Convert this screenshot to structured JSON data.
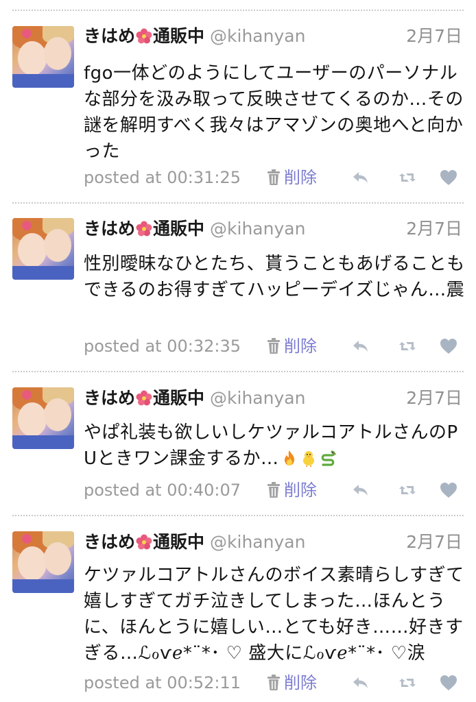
{
  "tweets": [
    {
      "name_a": "きはめ",
      "name_b": "通販中",
      "handle": "@kihanyan",
      "date": "2月7日",
      "text": "fgo一体どのようにしてユーザーのパーソナルな部分を汲み取って反映させてくるのか…その謎を解明すべく我々はアマゾンの奥地へと向かった",
      "text_suffix": "",
      "posted": "posted at 00:31:25",
      "delete_label": "削除"
    },
    {
      "name_a": "きはめ",
      "name_b": "通販中",
      "handle": "@kihanyan",
      "date": "2月7日",
      "text": "性別曖昧なひとたち、貰うこともあげることもできるのお得すぎてハッピーデイズじゃん…震",
      "text_suffix": "",
      "posted": "posted at 00:32:35",
      "delete_label": "削除"
    },
    {
      "name_a": "きはめ",
      "name_b": "通販中",
      "handle": "@kihanyan",
      "date": "2月7日",
      "text": "やぱ礼装も欲しいしケツァルコアトルさんのPUときワン課金するか…",
      "text_suffix": "",
      "posted": "posted at 00:40:07",
      "delete_label": "削除"
    },
    {
      "name_a": "きはめ",
      "name_b": "通販中",
      "handle": "@kihanyan",
      "date": "2月7日",
      "text": "ケツァルコアトルさんのボイス素晴らしすぎて嬉しすぎてガチ泣きしてしまった…ほんとうに、ほんとうに嬉しい…とても好き……好きすぎる…ℒℴѵℯ*¨*･ ♡ 盛大にℒℴѵℯ*¨*･ ♡涙",
      "text_suffix": "",
      "posted": "posted at 00:52:11",
      "delete_label": "削除"
    }
  ],
  "icons": {
    "name_emoji": "hibiscus-icon",
    "delete": "trash-icon",
    "reply": "reply-icon",
    "retweet": "retweet-icon",
    "favorite": "heart-icon",
    "tweet3_emojis": [
      "fire-icon",
      "chick-icon",
      "snake-icon"
    ]
  },
  "colors": {
    "delete_link": "#7c7ccf",
    "muted_text": "#9a9a9a",
    "action_icon": "#b5bdc8",
    "heart_icon": "#a9b4c2"
  }
}
